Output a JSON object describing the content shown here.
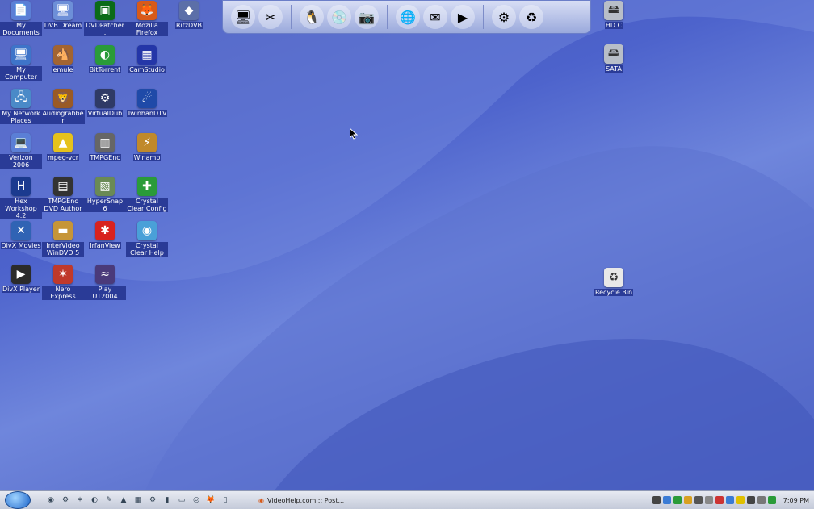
{
  "desktop_icons": [
    {
      "label": "My Documents",
      "glyph": "📄",
      "color": "#5b7fd6"
    },
    {
      "label": "DVB Dream",
      "glyph": "🖥",
      "color": "#6d8fd8"
    },
    {
      "label": "DVDPatcher ...",
      "glyph": "▣",
      "color": "#0b6b17"
    },
    {
      "label": "Mozilla Firefox",
      "glyph": "🦊",
      "color": "#d85a1a"
    },
    {
      "label": "RitzDVB",
      "glyph": "◆",
      "color": "#5c6fa8"
    },
    {
      "label": "My Computer",
      "glyph": "🖥",
      "color": "#3e74c9"
    },
    {
      "label": "emule",
      "glyph": "🐴",
      "color": "#a26431"
    },
    {
      "label": "BitTorrent",
      "glyph": "◐",
      "color": "#2a9b39"
    },
    {
      "label": "CamStudio",
      "glyph": "▦",
      "color": "#2436a8"
    },
    {
      "label": "My Network Places",
      "glyph": "🖧",
      "color": "#4a8ac8"
    },
    {
      "label": "Audiograbber",
      "glyph": "🦁",
      "color": "#9a5a25"
    },
    {
      "label": "VirtualDub",
      "glyph": "⚙",
      "color": "#2f3a66"
    },
    {
      "label": "TwinhanDTV",
      "glyph": "☄",
      "color": "#1f4aa8"
    },
    {
      "label": "Verizon 2006",
      "glyph": "💻",
      "color": "#5b7fd6"
    },
    {
      "label": "mpeg-vcr",
      "glyph": "▲",
      "color": "#e6c21c"
    },
    {
      "label": "TMPGEnc",
      "glyph": "▥",
      "color": "#666"
    },
    {
      "label": "Winamp",
      "glyph": "⚡",
      "color": "#c0892b"
    },
    {
      "label": "Hex Workshop 4.2",
      "glyph": "H",
      "color": "#1b3a8f"
    },
    {
      "label": "TMPGEnc DVD Author",
      "glyph": "▤",
      "color": "#333"
    },
    {
      "label": "HyperSnap 6",
      "glyph": "▧",
      "color": "#6a8a55"
    },
    {
      "label": "Crystal Clear Config",
      "glyph": "✚",
      "color": "#2a9b39"
    },
    {
      "label": "DivX Movies",
      "glyph": "✕",
      "color": "#3063b4"
    },
    {
      "label": "InterVideo WinDVD 5",
      "glyph": "▬",
      "color": "#c69538"
    },
    {
      "label": "IrfanView",
      "glyph": "✱",
      "color": "#d8221f"
    },
    {
      "label": "Crystal Clear Help",
      "glyph": "◉",
      "color": "#4aa0d8"
    },
    {
      "label": "DivX Player",
      "glyph": "▶",
      "color": "#2b2b2b"
    },
    {
      "label": "Nero Express",
      "glyph": "✶",
      "color": "#c0392b"
    },
    {
      "label": "Play UT2004",
      "glyph": "≈",
      "color": "#4a3a7a"
    }
  ],
  "right_icons": [
    {
      "label": "HD C",
      "glyph": "🖴",
      "color": "#b8bec8"
    },
    {
      "label": "SATA",
      "glyph": "🖴",
      "color": "#b8bec8"
    },
    {
      "label": "Recycle Bin",
      "glyph": "♻",
      "color": "#e8e8e8"
    }
  ],
  "dock": {
    "group1": [
      {
        "name": "monitor-icon",
        "glyph": "🖥"
      },
      {
        "name": "tools-icon",
        "glyph": "✂"
      }
    ],
    "group2": [
      {
        "name": "linux-drive-icon",
        "glyph": "🐧"
      },
      {
        "name": "disc-drive-icon",
        "glyph": "💿"
      },
      {
        "name": "camera-drive-icon",
        "glyph": "📷"
      }
    ],
    "group3": [
      {
        "name": "globe-icon",
        "glyph": "🌐"
      },
      {
        "name": "mail-icon",
        "glyph": "✉"
      },
      {
        "name": "media-player-icon",
        "glyph": "▶"
      }
    ],
    "group4": [
      {
        "name": "settings-gears-icon",
        "glyph": "⚙"
      },
      {
        "name": "recycle-icon",
        "glyph": "♻"
      }
    ]
  },
  "taskbar": {
    "quicklaunch": [
      "◉",
      "⚙",
      "✶",
      "◐",
      "✎",
      "▲",
      "▦",
      "⚙",
      "▮",
      "▭",
      "◎",
      "🦊",
      "▯"
    ],
    "active_task": "VideoHelp.com :: Post...",
    "clock": "7:09 PM",
    "tray_colors": [
      "#444",
      "#3a7bd5",
      "#2a9b39",
      "#d8a020",
      "#555",
      "#888",
      "#c33",
      "#3a7bd5",
      "#e0c000",
      "#444",
      "#777",
      "#2a9b39"
    ]
  }
}
